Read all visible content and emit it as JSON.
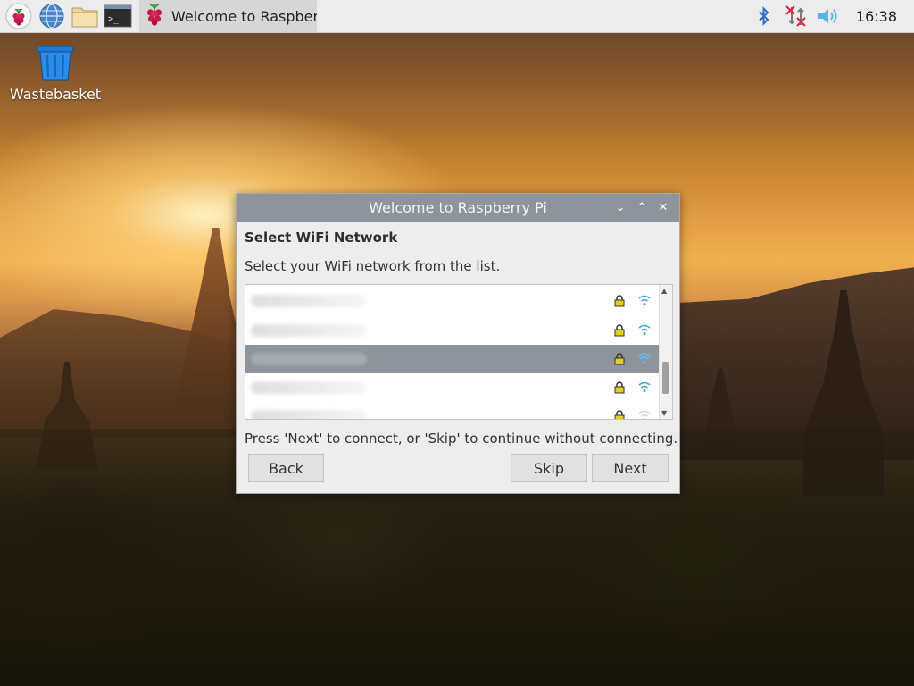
{
  "taskbar": {
    "launchers": [
      {
        "icon": "raspberry-menu-icon"
      },
      {
        "icon": "web-browser-icon"
      },
      {
        "icon": "file-manager-icon"
      },
      {
        "icon": "terminal-icon"
      }
    ],
    "task_button": {
      "label": "Welcome to Raspberr...",
      "icon": "raspberry-pi-icon"
    },
    "tray": {
      "bluetooth_icon": "bluetooth-icon",
      "network_icon": "network-disconnected-icon",
      "volume_icon": "volume-icon"
    },
    "clock": "16:38"
  },
  "desktop": {
    "icons": [
      {
        "label": "Wastebasket",
        "icon": "wastebasket-icon"
      }
    ]
  },
  "dialog": {
    "title": "Welcome to Raspberry Pi",
    "controls": {
      "minimize": "⌄",
      "maximize": "⌃",
      "close": "✕"
    },
    "heading": "Select WiFi Network",
    "subtext": "Select your WiFi network from the list.",
    "networks": [
      {
        "ssid": "",
        "secured": true,
        "signal": "strong",
        "selected": false
      },
      {
        "ssid": "",
        "secured": true,
        "signal": "strong",
        "selected": false
      },
      {
        "ssid": "",
        "secured": true,
        "signal": "strong",
        "selected": true
      },
      {
        "ssid": "",
        "secured": true,
        "signal": "strong",
        "selected": false
      },
      {
        "ssid": "",
        "secured": true,
        "signal": "weak",
        "selected": false
      }
    ],
    "hint": "Press 'Next' to connect, or 'Skip' to continue without connecting.",
    "buttons": {
      "back": "Back",
      "skip": "Skip",
      "next": "Next"
    }
  },
  "colors": {
    "selection": "#8d949b",
    "titlebar": "#8d949b",
    "signal": "#3aa6d8",
    "lock": "#d9c21a"
  }
}
